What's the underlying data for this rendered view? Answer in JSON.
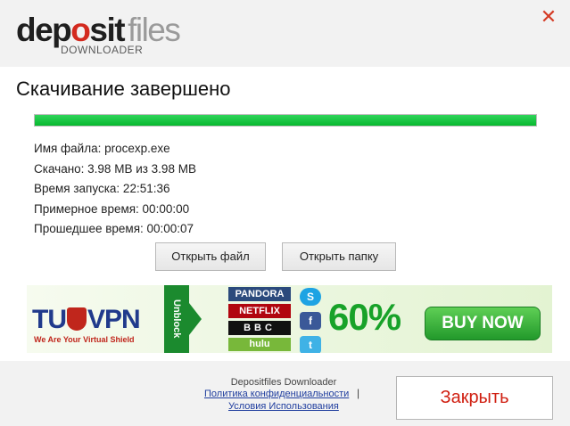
{
  "header": {
    "logo": {
      "part1": "dep",
      "part_o": "o",
      "part2": "sit",
      "files": "files",
      "sub": "DOWNLOADER"
    },
    "close_glyph": "✕"
  },
  "title": "Скачивание завершено",
  "progress": {
    "fraction": 1.0
  },
  "info": {
    "filename": "Имя файла: procexp.exe",
    "downloaded": "Скачано: 3.98 MB из 3.98 MB",
    "start_time": "Время запуска: 22:51:36",
    "estimated": "Примерное время: 00:00:00",
    "elapsed": "Прошедшее время: 00:00:07"
  },
  "buttons": {
    "open_file": "Открыть файл",
    "open_folder": "Открыть папку"
  },
  "banner": {
    "vpn_left": "TU",
    "vpn_right": "VPN",
    "vpn_tagline": "We Are Your Virtual Shield",
    "unblock": "Unblock",
    "services": [
      "PANDORA",
      "NETFLIX",
      "BBC",
      "hulu"
    ],
    "social": [
      "S",
      "f",
      "t"
    ],
    "percent": "60%",
    "buy_now": "BUY NOW"
  },
  "footer": {
    "app_name": "Depositfiles Downloader",
    "privacy": "Политика конфиденциальности",
    "separator": "|",
    "terms": "Условия Использования",
    "close": "Закрыть"
  },
  "colors": {
    "accent_red": "#d01f11",
    "progress_green": "#08b82f",
    "link_blue": "#1f3d9e"
  }
}
